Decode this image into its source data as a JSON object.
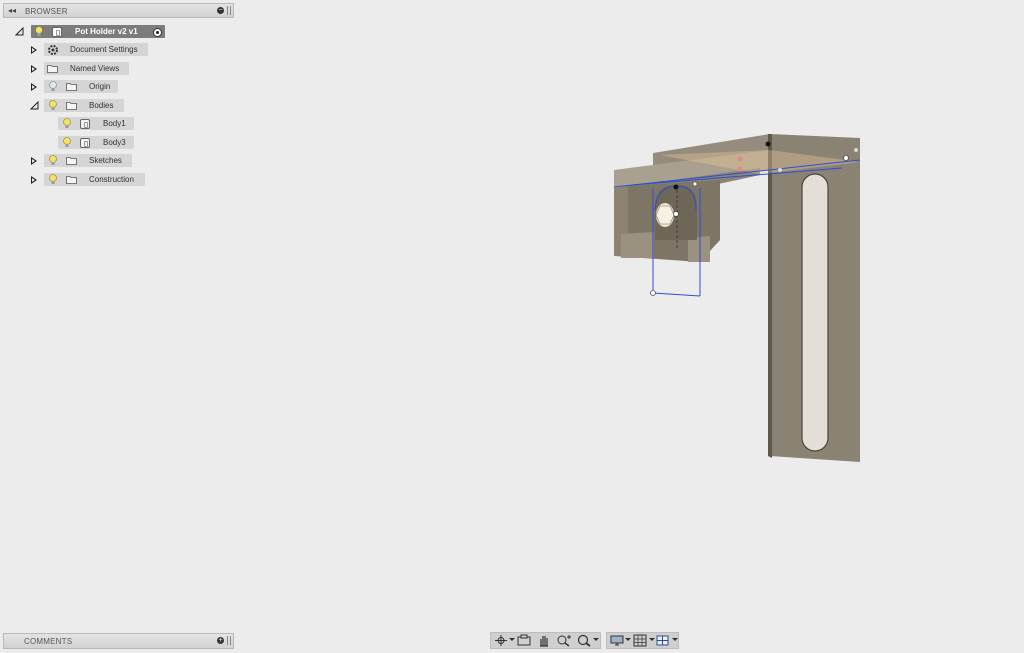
{
  "browser": {
    "title": "BROWSER",
    "root": {
      "label": "Pot Holder v2 v1"
    },
    "items": [
      {
        "label": "Document Settings"
      },
      {
        "label": "Named Views"
      },
      {
        "label": "Origin"
      },
      {
        "label": "Bodies"
      },
      {
        "label": "Body1"
      },
      {
        "label": "Body3"
      },
      {
        "label": "Sketches"
      },
      {
        "label": "Construction"
      }
    ]
  },
  "comments": {
    "title": "COMMENTS"
  },
  "colors": {
    "panel_bar": "#d9d9d9",
    "root_highlight": "#7c7c7c",
    "item_highlight": "#d5d5d5",
    "model_face": "#8a8273",
    "sketch_line": "#2a4fd6"
  },
  "nav_toolbar": {
    "icons": [
      "orbit-icon",
      "look-at-icon",
      "pan-icon",
      "zoom-icon",
      "zoom-window-icon",
      "display-settings-icon",
      "grid-icon",
      "viewports-icon"
    ]
  }
}
